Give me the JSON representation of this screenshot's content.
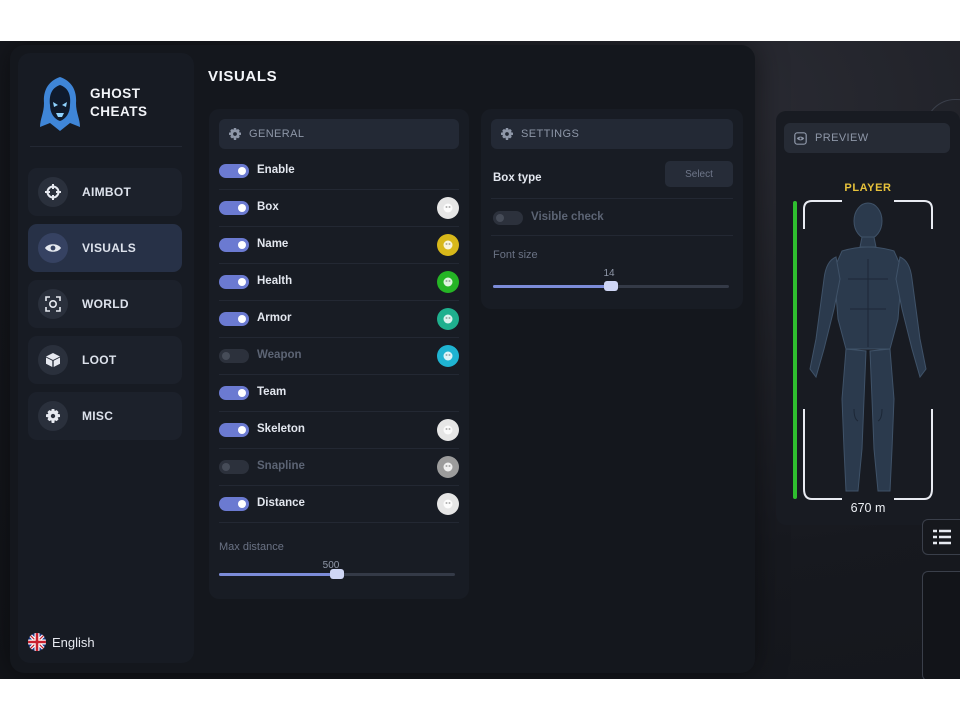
{
  "brand": {
    "line1": "GHOST",
    "line2": "CHEATS"
  },
  "sidebar": {
    "items": [
      {
        "label": "AIMBOT",
        "icon": "crosshair-icon"
      },
      {
        "label": "VISUALS",
        "icon": "eye-icon",
        "active": true
      },
      {
        "label": "WORLD",
        "icon": "world-scan-icon"
      },
      {
        "label": "LOOT",
        "icon": "box-icon"
      },
      {
        "label": "MISC",
        "icon": "gear-icon"
      }
    ],
    "language": "English"
  },
  "page_title": "VISUALS",
  "general": {
    "title": "GENERAL",
    "rows": [
      {
        "label": "Enable",
        "on": true
      },
      {
        "label": "Box",
        "on": true,
        "color": "#e6e6e6"
      },
      {
        "label": "Name",
        "on": true,
        "color": "#d8b81a"
      },
      {
        "label": "Health",
        "on": true,
        "color": "#25b525"
      },
      {
        "label": "Armor",
        "on": true,
        "color": "#1fb08e"
      },
      {
        "label": "Weapon",
        "on": false,
        "color": "#1fb4d2"
      },
      {
        "label": "Team",
        "on": true
      },
      {
        "label": "Skeleton",
        "on": true,
        "color": "#e6e6e6"
      },
      {
        "label": "Snapline",
        "on": false,
        "color": "#9c9c9c"
      },
      {
        "label": "Distance",
        "on": true,
        "color": "#e6e6e6"
      }
    ],
    "max_distance": {
      "label": "Max distance",
      "value": "500",
      "fraction": 0.5
    }
  },
  "settings": {
    "title": "SETTINGS",
    "box_type": {
      "label": "Box type",
      "button": "Select"
    },
    "visible_check": {
      "label": "Visible check",
      "on": false
    },
    "font_size": {
      "label": "Font size",
      "value": "14",
      "fraction": 0.5
    }
  },
  "preview": {
    "title": "PREVIEW",
    "player_label": "PLAYER",
    "distance": "670 m",
    "colors": {
      "player_label": "#e7c23b",
      "health_bar": "#2fbf2f"
    }
  },
  "colors": {
    "accent": "#6b7ad1",
    "window_bg": "#14171d",
    "panel_bg": "#181c24"
  }
}
